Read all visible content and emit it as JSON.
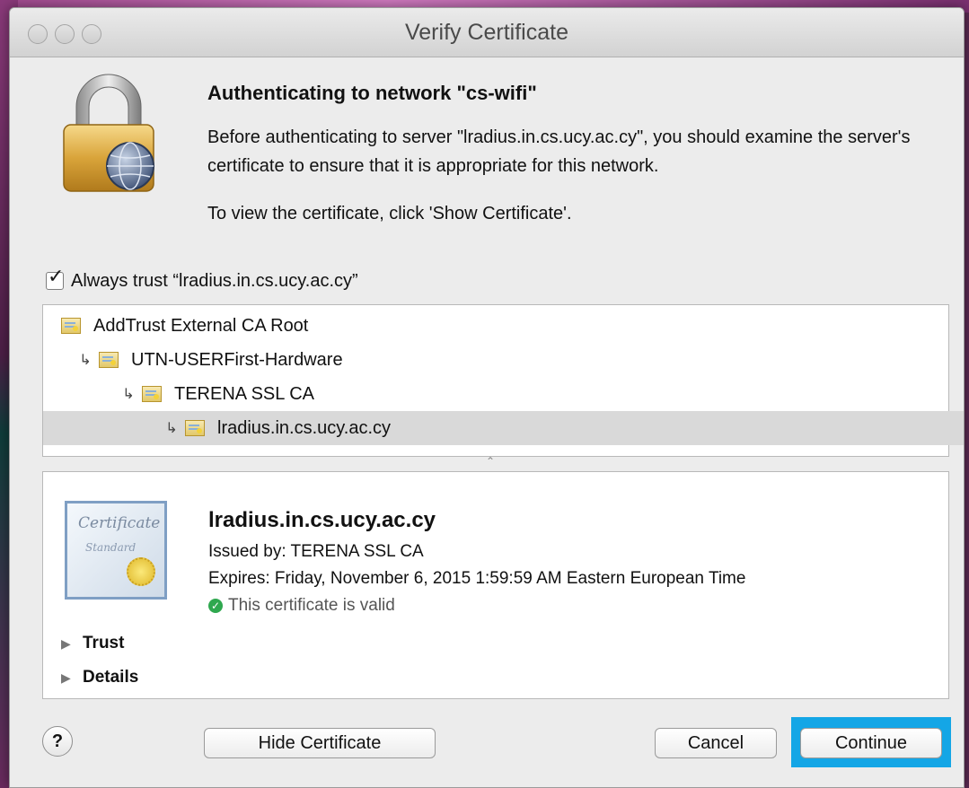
{
  "window": {
    "title": "Verify Certificate"
  },
  "header": {
    "heading": "Authenticating to network \"cs-wifi\"",
    "description": "Before authenticating to server \"lradius.in.cs.ucy.ac.cy\", you should examine the server's certificate to ensure that it is appropriate for this network.",
    "hint": "To view the certificate, click 'Show Certificate'."
  },
  "always_trust": {
    "label": "Always trust “lradius.in.cs.ucy.ac.cy”",
    "checked": true
  },
  "chain": [
    {
      "label": "AddTrust External CA Root",
      "level": 0,
      "selected": false
    },
    {
      "label": "UTN-USERFirst-Hardware",
      "level": 1,
      "selected": false
    },
    {
      "label": "TERENA SSL CA",
      "level": 2,
      "selected": false
    },
    {
      "label": "lradius.in.cs.ucy.ac.cy",
      "level": 3,
      "selected": true
    }
  ],
  "certificate": {
    "image_text_1": "Certificate",
    "image_text_2": "Standard",
    "name": "lradius.in.cs.ucy.ac.cy",
    "issued_by": "Issued by: TERENA SSL CA",
    "expires": "Expires: Friday, November 6, 2015 1:59:59 AM Eastern European Time",
    "status": "This certificate is valid",
    "sections": [
      "Trust",
      "Details"
    ]
  },
  "buttons": {
    "help": "?",
    "hide_certificate": "Hide Certificate",
    "cancel": "Cancel",
    "continue": "Continue"
  },
  "colors": {
    "focus_ring": "#14a6e6",
    "valid": "#2fa84f",
    "selected_row": "#d9d9d9"
  }
}
